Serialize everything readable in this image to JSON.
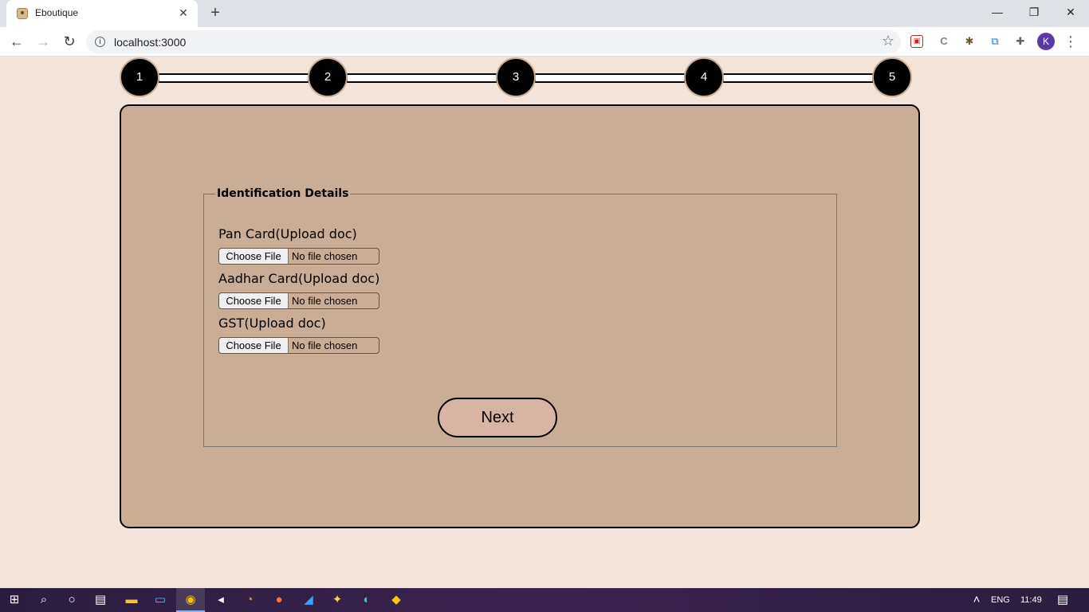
{
  "browser": {
    "tab_title": "Eboutique",
    "tab_close": "✕",
    "new_tab": "+",
    "url": "localhost:3000",
    "avatar_initial": "K",
    "window_controls": {
      "minimize": "—",
      "maximize": "❐",
      "close": "✕"
    }
  },
  "stepper": {
    "steps": [
      "1",
      "2",
      "3",
      "4",
      "5"
    ]
  },
  "form": {
    "legend": "Identification Details",
    "fields": [
      {
        "label": "Pan Card(Upload doc)",
        "button": "Choose File",
        "status": "No file chosen"
      },
      {
        "label": "Aadhar Card(Upload doc)",
        "button": "Choose File",
        "status": "No file chosen"
      },
      {
        "label": "GST(Upload doc)",
        "button": "Choose File",
        "status": "No file chosen"
      }
    ],
    "next_label": "Next"
  },
  "taskbar": {
    "language": "ENG",
    "time": "11:49"
  },
  "colors": {
    "page_background": "#f2e4d8",
    "card_background": "#c9ae95",
    "next_button": "#d8b4a5",
    "step_circle": "#000000"
  }
}
